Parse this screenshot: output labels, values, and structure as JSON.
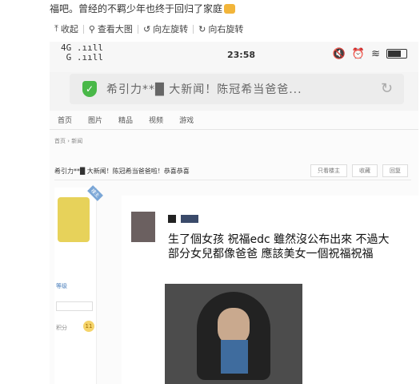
{
  "caption": {
    "text": "福吧。曾经的不羁少年也终于回归了家庭"
  },
  "toolbar": {
    "items": [
      "收起",
      "查看大图",
      "向左旋转",
      "向右旋转"
    ],
    "icons": [
      "up-arrow-icon",
      "magnifier-icon",
      "rotate-left-icon",
      "rotate-right-icon"
    ]
  },
  "status": {
    "network_top": "4G",
    "network_bottom": "G",
    "time": "23:58"
  },
  "address": {
    "url": "希引力**█ 大新闻！陈冠希当爸爸..."
  },
  "nav": {
    "items": [
      "首页",
      "图片",
      "精品",
      "视频",
      "游戏"
    ]
  },
  "breadcrumb": {
    "text": "首页 › 新闻"
  },
  "thread": {
    "title": "希引力**█ 大新闻！陈冠希当爸爸啦！恭喜恭喜",
    "buttons": [
      "只看楼主",
      "收藏",
      "回复"
    ]
  },
  "sidebar": {
    "tag": "楼主",
    "level": "等级",
    "points": "积分",
    "medal_count": "11"
  },
  "post": {
    "text": "生了個女孩 祝福edc 雖然沒公布出來 不過大部分女兒都像爸爸 應該美女一個祝福祝福"
  },
  "colors": {
    "accent_green": "#49b848",
    "thumb_yellow": "#f2b53a"
  }
}
